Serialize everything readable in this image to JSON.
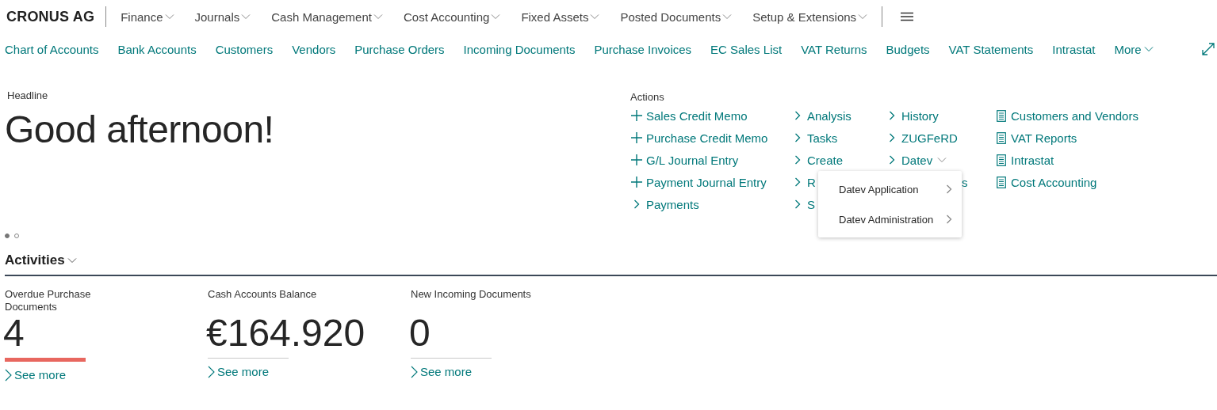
{
  "app_bar": {
    "company": "CRONUS AG",
    "menus": [
      {
        "label": "Finance"
      },
      {
        "label": "Journals"
      },
      {
        "label": "Cash Management"
      },
      {
        "label": "Cost Accounting"
      },
      {
        "label": "Fixed Assets"
      },
      {
        "label": "Posted Documents"
      },
      {
        "label": "Setup & Extensions"
      }
    ]
  },
  "nav_links": {
    "items": [
      "Chart of Accounts",
      "Bank Accounts",
      "Customers",
      "Vendors",
      "Purchase Orders",
      "Incoming Documents",
      "Purchase Invoices",
      "EC Sales List",
      "VAT Returns",
      "Budgets",
      "VAT Statements",
      "Intrastat"
    ],
    "more": "More"
  },
  "headline": {
    "label": "Headline",
    "text": "Good afternoon!",
    "pages": [
      {
        "selected": true
      },
      {
        "selected": false
      }
    ]
  },
  "actions": {
    "label": "Actions",
    "columns": [
      [
        {
          "kind": "new",
          "label": "Sales Credit Memo"
        },
        {
          "kind": "new",
          "label": "Purchase Credit Memo"
        },
        {
          "kind": "new",
          "label": "G/L Journal Entry"
        },
        {
          "kind": "new",
          "label": "Payment Journal Entry"
        },
        {
          "kind": "group",
          "label": "Payments"
        }
      ],
      [
        {
          "kind": "group",
          "label": "Analysis"
        },
        {
          "kind": "group",
          "label": "Tasks"
        },
        {
          "kind": "group",
          "label": "Create"
        },
        {
          "kind": "group",
          "label": "R"
        },
        {
          "kind": "group",
          "label": "S"
        }
      ],
      [
        {
          "kind": "group",
          "label": "History"
        },
        {
          "kind": "group",
          "label": "ZUGFeRD"
        },
        {
          "kind": "menu",
          "label": "Datev",
          "expanded": true
        },
        {
          "kind": "fragment",
          "label": "s"
        }
      ],
      [
        {
          "kind": "report",
          "label": "Customers and Vendors"
        },
        {
          "kind": "report",
          "label": "VAT Reports"
        },
        {
          "kind": "report",
          "label": "Intrastat"
        },
        {
          "kind": "report",
          "label": "Cost Accounting"
        }
      ]
    ],
    "submenu": [
      "Datev Application",
      "Datev Administration"
    ]
  },
  "activities": {
    "title": "Activities",
    "tiles": [
      {
        "title": "Overdue Purchase Documents",
        "value": "4",
        "color": "#e8675f",
        "link": "See more"
      },
      {
        "title": "Cash Accounts Balance",
        "value": "€164.920",
        "color": "#c8c8c8",
        "link": "See more"
      },
      {
        "title": "New Incoming Documents",
        "value": "0",
        "color": "#c8c8c8",
        "link": "See more"
      }
    ]
  }
}
